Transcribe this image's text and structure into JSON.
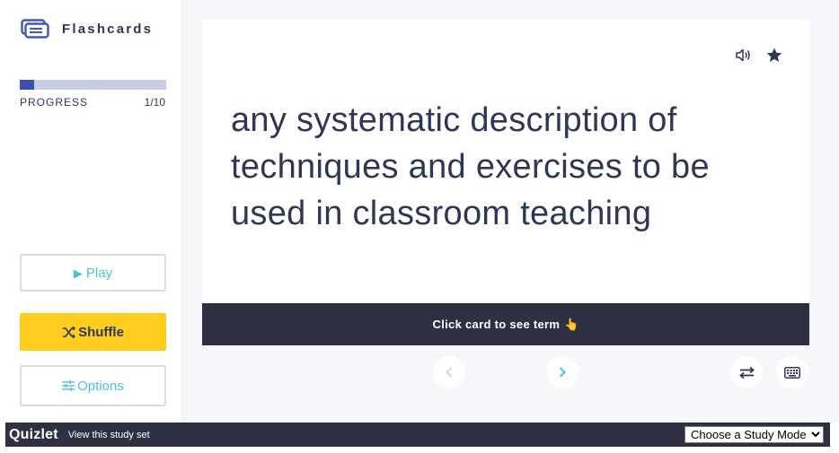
{
  "sidebar": {
    "title": "Flashcards",
    "progress_label": "PROGRESS",
    "progress_count": "1/10",
    "progress_fraction": 0.1,
    "play_label": "Play",
    "shuffle_label": "Shuffle",
    "options_label": "Options"
  },
  "card": {
    "text": "any systematic description of techniques and exercises to be used in classroom teaching",
    "hint": "Click card to see term",
    "icons": [
      "audio-icon",
      "star-icon",
      "pointing-hand-icon"
    ]
  },
  "controls": {
    "icons": [
      "chevron-left-icon",
      "chevron-right-icon",
      "swap-arrows-icon",
      "keyboard-icon"
    ]
  },
  "footer": {
    "logo": "Quizlet",
    "link": "View this study set",
    "mode_select": {
      "selected": "Choose a Study Mode",
      "options": [
        "Choose a Study Mode"
      ]
    }
  },
  "colors": {
    "accent_teal": "#4fc3d6",
    "shuffle_yellow": "#ffcd1f",
    "progress_fill": "#3c4fb0",
    "progress_track": "#c8cce6",
    "dark_bar": "#2e3142",
    "text": "#2e3856"
  }
}
